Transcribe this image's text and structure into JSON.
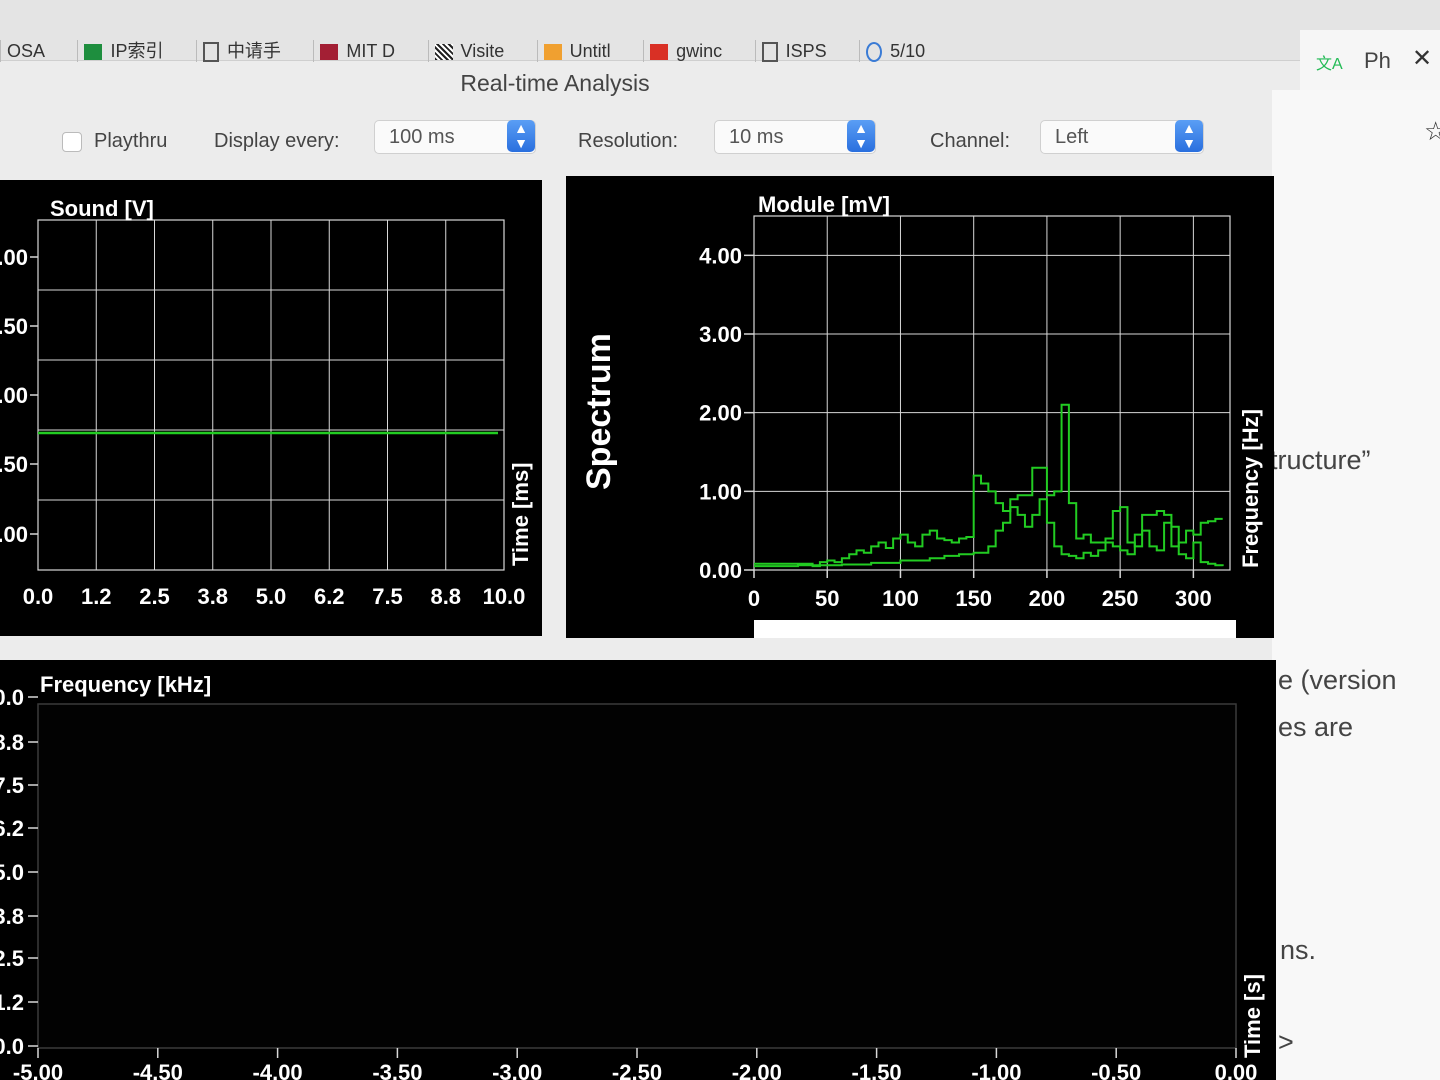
{
  "browser": {
    "tabs": [
      "OSA",
      "IP索引",
      "中请手",
      "MIT D",
      "Visite",
      "Untitl",
      "gwinc",
      "ISPS",
      "5/10"
    ],
    "right_tab": {
      "label": "Ph",
      "close": "✕"
    },
    "page_fragments": [
      "tructure”",
      "e (version",
      "es are",
      "ns.",
      ">"
    ]
  },
  "window": {
    "title": "Real-time Analysis",
    "playthru_label": "Playthru",
    "display_every_label": "Display every:",
    "display_every_value": "100 ms",
    "resolution_label": "Resolution:",
    "resolution_value": "10 ms",
    "channel_label": "Channel:",
    "channel_value": "Left"
  },
  "colors": {
    "accent": "#2a6fde",
    "trace": "#22cc22",
    "grid": "#d8d8d8",
    "panel": "#000000"
  },
  "chart_data": [
    {
      "type": "line",
      "title": "Sound [V]",
      "xlabel": "Time [ms]",
      "ylabel": "",
      "x_ticks": [
        "0.0",
        "1.2",
        "2.5",
        "3.8",
        "5.0",
        "6.2",
        "7.5",
        "8.8",
        "10.0"
      ],
      "y_ticks": [
        ".00",
        ".50",
        ".00",
        ".50",
        ".00"
      ],
      "xlim": [
        0,
        10
      ],
      "ylim": [
        -1,
        1
      ],
      "series": [
        {
          "x": [
            0,
            10
          ],
          "values": [
            0,
            0
          ]
        }
      ]
    },
    {
      "type": "line",
      "title": "Module [mV]",
      "side_label": "Spectrum",
      "xlabel": "Frequency [Hz]",
      "ylabel": "",
      "x_ticks": [
        "0",
        "50",
        "100",
        "150",
        "200",
        "250",
        "300"
      ],
      "y_ticks": [
        "4.00",
        "3.00",
        "2.00",
        "1.00",
        "0.00"
      ],
      "xlim": [
        0,
        325
      ],
      "ylim": [
        0,
        4.5
      ],
      "series": [
        {
          "x": [
            0,
            10,
            20,
            30,
            40,
            45,
            50,
            55,
            60,
            65,
            70,
            75,
            80,
            85,
            90,
            95,
            100,
            105,
            110,
            115,
            120,
            125,
            130,
            135,
            140,
            145,
            150,
            155,
            160,
            165,
            170,
            175,
            180,
            185,
            190,
            195,
            200,
            205,
            210,
            215,
            220,
            225,
            230,
            235,
            240,
            245,
            250,
            255,
            260,
            265,
            270,
            275,
            280,
            285,
            290,
            295,
            300,
            305,
            310,
            315,
            320
          ],
          "values": [
            0.05,
            0.05,
            0.05,
            0.06,
            0.05,
            0.1,
            0.12,
            0.1,
            0.15,
            0.2,
            0.25,
            0.22,
            0.3,
            0.35,
            0.28,
            0.4,
            0.45,
            0.35,
            0.3,
            0.45,
            0.5,
            0.4,
            0.38,
            0.35,
            0.4,
            0.42,
            1.2,
            1.1,
            1.0,
            0.85,
            0.75,
            0.9,
            0.95,
            0.95,
            1.3,
            1.3,
            0.95,
            1.0,
            2.1,
            0.85,
            0.4,
            0.45,
            0.35,
            0.35,
            0.4,
            0.75,
            0.8,
            0.35,
            0.3,
            0.7,
            0.7,
            0.75,
            0.7,
            0.3,
            0.35,
            0.5,
            0.45,
            0.6,
            0.62,
            0.65,
            0.65
          ]
        },
        {
          "x": [
            0,
            20,
            40,
            60,
            80,
            100,
            120,
            130,
            140,
            150,
            160,
            165,
            170,
            175,
            180,
            185,
            190,
            195,
            200,
            205,
            210,
            215,
            220,
            225,
            230,
            235,
            240,
            245,
            250,
            255,
            260,
            265,
            270,
            275,
            280,
            285,
            290,
            295,
            300,
            305,
            310,
            315,
            320
          ],
          "values": [
            0.08,
            0.08,
            0.06,
            0.07,
            0.09,
            0.12,
            0.15,
            0.18,
            0.2,
            0.22,
            0.3,
            0.5,
            0.6,
            0.8,
            0.7,
            0.55,
            0.7,
            0.9,
            0.6,
            0.3,
            0.2,
            0.18,
            0.15,
            0.22,
            0.18,
            0.25,
            0.35,
            0.3,
            0.25,
            0.2,
            0.45,
            0.5,
            0.3,
            0.25,
            0.6,
            0.55,
            0.2,
            0.15,
            0.35,
            0.1,
            0.08,
            0.06,
            0.05
          ]
        }
      ]
    },
    {
      "type": "heatmap",
      "title": "Frequency [kHz]",
      "xlabel": "Time [s]",
      "ylabel": "",
      "x_ticks": [
        "-5.00",
        "-4.50",
        "-4.00",
        "-3.50",
        "-3.00",
        "-2.50",
        "-2.00",
        "-1.50",
        "-1.00",
        "-0.50",
        "0.00"
      ],
      "y_ticks": [
        "0.0",
        "8.8",
        "7.5",
        "6.2",
        "5.0",
        "3.8",
        "2.5",
        "1.2",
        "0.0"
      ],
      "xlim": [
        -5,
        0
      ],
      "ylim": [
        0,
        10
      ],
      "values": []
    }
  ]
}
